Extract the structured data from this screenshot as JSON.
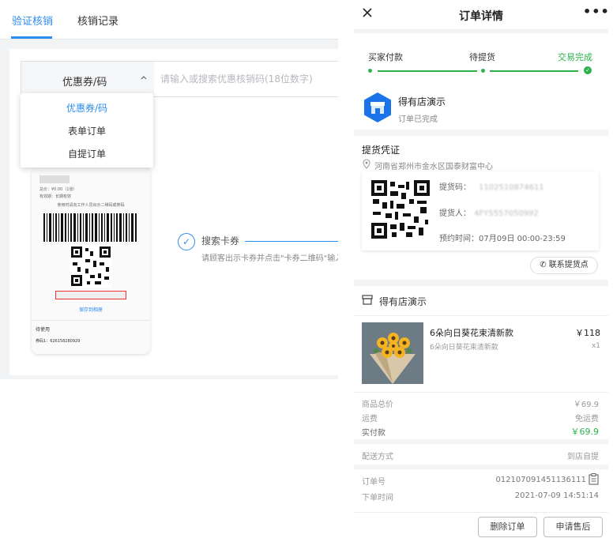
{
  "left": {
    "tabs": [
      {
        "label": "验证核销",
        "active": true
      },
      {
        "label": "核销记录",
        "active": false
      }
    ],
    "select": {
      "value": "优惠券/码",
      "chevron_icon": "chevron-up-icon"
    },
    "search": {
      "placeholder": "请输入或搜索优惠核销码(18位数字)"
    },
    "dropdown": [
      {
        "label": "优惠券/码",
        "selected": true
      },
      {
        "label": "表单订单",
        "selected": false
      },
      {
        "label": "自提订单",
        "selected": false
      }
    ],
    "phone_preview": {
      "lines": [
        "总价：¥0.00（1张）",
        "有效期：长期有效"
      ],
      "instruction": "使用时请向工作人员出示二维码或券码",
      "save_link": "保存到相册",
      "status": "待使用",
      "code_label": "券码1：",
      "code_value": "626158280929"
    },
    "step": {
      "icon": "check-icon",
      "title": "搜索卡券",
      "desc": "请顾客出示卡券并点击\"卡券二维码\"输入"
    },
    "accent": "#2d8cf0"
  },
  "right": {
    "header": {
      "title": "订单详情",
      "close_icon": "close-icon",
      "more_icon": "more-icon"
    },
    "progress": {
      "steps": [
        "买家付款",
        "待提货",
        "交易完成"
      ],
      "done_color": "#2bb24c"
    },
    "store": {
      "name": "得有店演示",
      "status": "订单已完成",
      "icon": "store-icon"
    },
    "pickup": {
      "title": "提货凭证",
      "address": "河南省郑州市金水区国泰财富中心",
      "code_label": "提货码：",
      "code_value": "1102510874611",
      "person_label": "提货人：",
      "person_value": "4FY5557050992",
      "time_label": "预约时间：",
      "time_value": "07月09日 00:00-23:59",
      "contact_button": "联系提货点"
    },
    "shop": {
      "name": "得有店演示",
      "icon": "shop-icon"
    },
    "product": {
      "name": "6朵向日葵花束清新款",
      "spec": "6朵向日葵花束清新款",
      "price": "￥118",
      "qty": "x1"
    },
    "summary": [
      {
        "label": "商品总价",
        "value": "￥69.9"
      },
      {
        "label": "运费",
        "value": "免运费"
      },
      {
        "label": "实付款",
        "value": "￥69.9"
      }
    ],
    "delivery": {
      "label": "配送方式",
      "value": "到店自提"
    },
    "order": [
      {
        "label": "订单号",
        "value": "012107091451136111"
      },
      {
        "label": "下单时间",
        "value": "2021-07-09 14:51:14"
      }
    ],
    "buttons": {
      "delete": "删除订单",
      "after_sale": "申请售后"
    }
  }
}
